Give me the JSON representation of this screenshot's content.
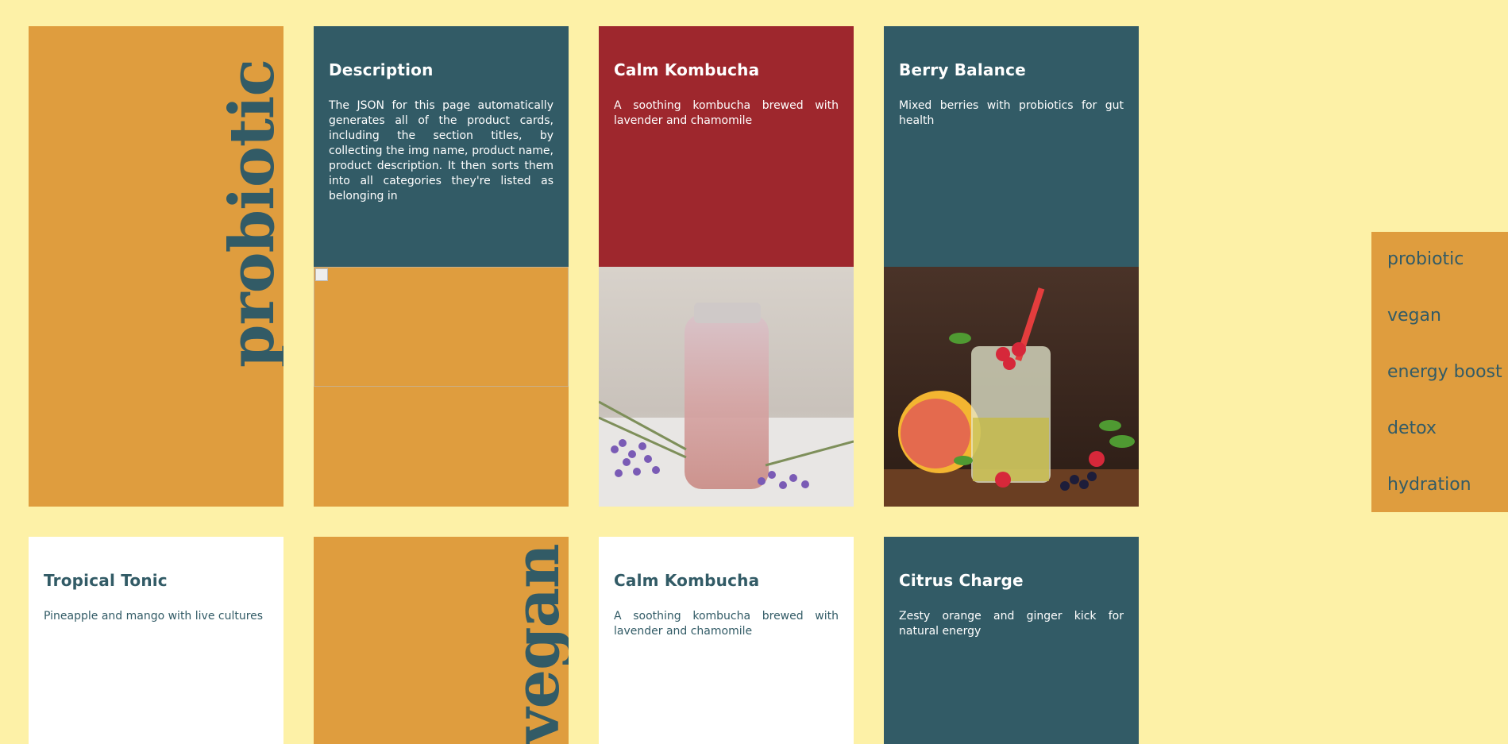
{
  "sections": {
    "probiotic": "probiotic",
    "vegan": "vegan"
  },
  "cards": {
    "description": {
      "title": "Description",
      "text": "The JSON for this page automatically generates all of the product cards, including the section titles, by collecting the img name, product name, product description. It then sorts them into all categories they're listed as belonging in"
    },
    "calm_kombucha_1": {
      "title": "Calm Kombucha",
      "text": "A soothing kombucha brewed with lavender and chamomile"
    },
    "berry_balance": {
      "title": "Berry Balance",
      "text": "Mixed berries with probiotics for gut health"
    },
    "tropical_tonic": {
      "title": "Tropical Tonic",
      "text": "Pineapple and mango with live cultures"
    },
    "calm_kombucha_2": {
      "title": "Calm Kombucha",
      "text": "A soothing kombucha brewed with lavender and chamomile"
    },
    "citrus_charge": {
      "title": "Citrus Charge",
      "text": "Zesty orange and ginger kick for natural energy"
    }
  },
  "sidebar": {
    "items": [
      "probiotic",
      "vegan",
      "energy boost",
      "detox",
      "hydration"
    ]
  },
  "colors": {
    "background": "#fdf1a7",
    "mustard": "#df9d3e",
    "teal": "#325b66",
    "red": "#9e272d",
    "white": "#ffffff"
  }
}
